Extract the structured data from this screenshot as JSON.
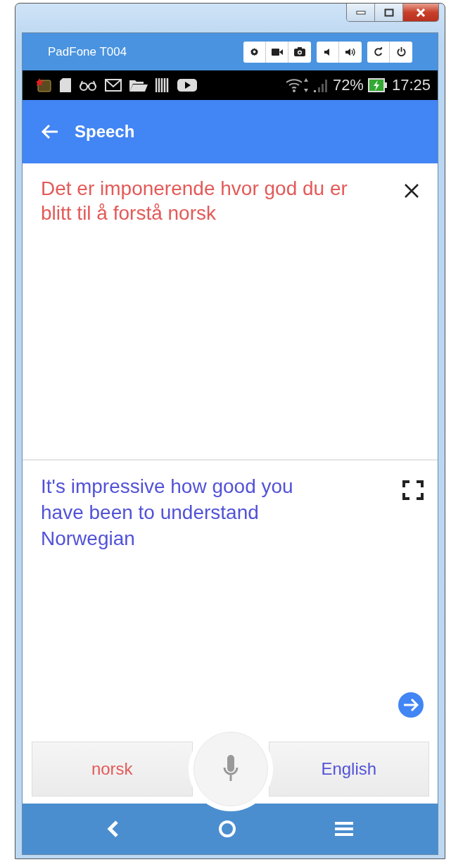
{
  "emulator": {
    "device_name": "PadFone T004"
  },
  "status_bar": {
    "battery": "72%",
    "time": "17:25"
  },
  "app_bar": {
    "title": "Speech"
  },
  "source": {
    "text": "Det er imponerende hvor god du er blitt til å forstå norsk"
  },
  "translation": {
    "text": "It's impressive how good you have been to understand Norwegian"
  },
  "languages": [
    {
      "label": "norsk"
    },
    {
      "label": "English"
    }
  ]
}
